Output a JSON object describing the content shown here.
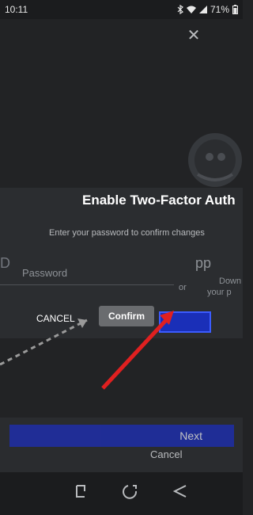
{
  "status_bar": {
    "time": "10:11",
    "battery": "71%"
  },
  "dialog": {
    "title": "Enable Two-Factor Auth",
    "subtitle": "Enter your password to confirm changes",
    "password_placeholder": "Password",
    "cancel_label": "CANCEL",
    "confirm_label": "Confirm"
  },
  "background": {
    "left_fragment": "D",
    "right_fragment_app": "pp",
    "right_fragment_or": "or",
    "right_fragment_down": "Down",
    "right_fragment_your": "your p",
    "next_label": "Next",
    "cancel_label": "Cancel"
  },
  "icons": {
    "close": "close-icon",
    "nav_recent": "recent-apps-icon",
    "nav_home": "home-icon",
    "nav_back": "back-icon"
  },
  "colors": {
    "annotation_arrow": "#e02020",
    "highlight": "#1a2fb8",
    "confirm_button": "#6a6c6f"
  }
}
